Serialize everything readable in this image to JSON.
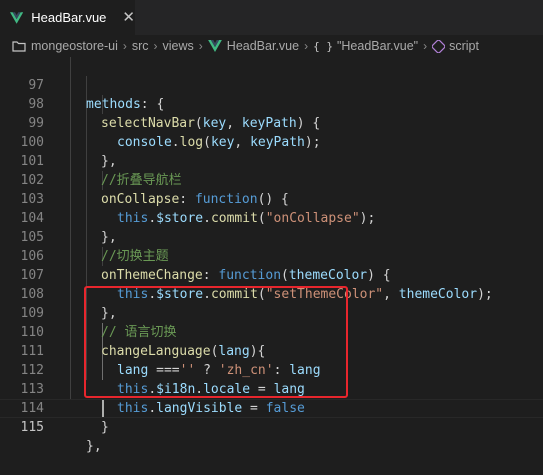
{
  "tab": {
    "filename": "HeadBar.vue",
    "close_glyph": "✕",
    "icon": "vue-icon",
    "icon_color": "#41b883"
  },
  "breadcrumb": {
    "items": [
      "mongeostore-ui",
      "src",
      "views",
      "HeadBar.vue",
      "\"HeadBar.vue\"",
      "script"
    ],
    "separator": "›",
    "braces": "{ }"
  },
  "editor": {
    "active_line": 115,
    "lines": [
      {
        "n": "97"
      },
      {
        "n": "98"
      },
      {
        "n": "99"
      },
      {
        "n": "100"
      },
      {
        "n": "101"
      },
      {
        "n": "102"
      },
      {
        "n": "103"
      },
      {
        "n": "104"
      },
      {
        "n": "105"
      },
      {
        "n": "106"
      },
      {
        "n": "107"
      },
      {
        "n": "108"
      },
      {
        "n": "109"
      },
      {
        "n": "110"
      },
      {
        "n": "111"
      },
      {
        "n": "112"
      },
      {
        "n": "113"
      },
      {
        "n": "114"
      },
      {
        "n": "115"
      }
    ],
    "code": {
      "l97": [
        "methods",
        ": {"
      ],
      "l98": [
        "selectNavBar",
        "(",
        "key",
        ", ",
        "keyPath",
        ") {"
      ],
      "l99": [
        "console",
        ".",
        "log",
        "(",
        "key",
        ", ",
        "keyPath",
        ");"
      ],
      "l100": [
        "},"
      ],
      "l101": [
        "//折叠导航栏"
      ],
      "l102": [
        "onCollapse",
        ": ",
        "function",
        "() {"
      ],
      "l103": [
        "this",
        ".",
        "$store",
        ".",
        "commit",
        "(",
        "\"onCollapse\"",
        ");"
      ],
      "l104": [
        "},"
      ],
      "l105": [
        "//切换主题"
      ],
      "l106": [
        "onThemeChange",
        ": ",
        "function",
        "(",
        "themeColor",
        ") {"
      ],
      "l107": [
        "this",
        ".",
        "$store",
        ".",
        "commit",
        "(",
        "\"setThemeColor\"",
        ", ",
        "themeColor",
        ");"
      ],
      "l108": [
        "},"
      ],
      "l109": [
        "// 语言切换"
      ],
      "l110": [
        "changeLanguage",
        "(",
        "lang",
        "){"
      ],
      "l111": [
        "lang",
        " ===",
        "''",
        " ? ",
        "'zh_cn'",
        ": ",
        "lang"
      ],
      "l112": [
        "this",
        ".",
        "$i18n",
        ".",
        "locale",
        " = ",
        "lang"
      ],
      "l113": [
        "this",
        ".",
        "langVisible",
        " = ",
        "false"
      ],
      "l114": [
        "}"
      ],
      "l115": [
        "},"
      ]
    },
    "colors": {
      "background": "#1e1e1e",
      "property": "#9cdcfe",
      "function": "#dcdcaa",
      "keyword": "#569cd6",
      "string": "#ce9178",
      "comment": "#6a9955",
      "highlight_border": "#e8262d"
    }
  }
}
